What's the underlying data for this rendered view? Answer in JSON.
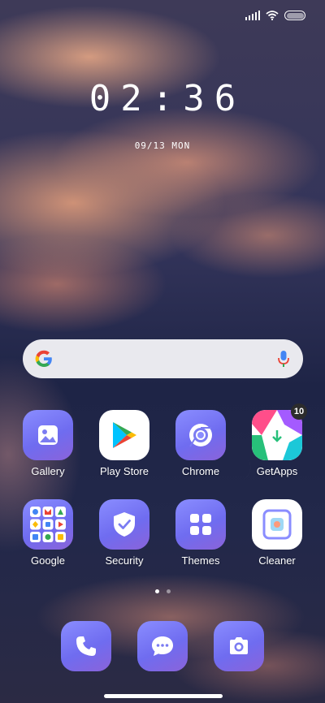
{
  "status_bar": {
    "icons": [
      "signal-icon",
      "wifi-icon",
      "battery-icon"
    ]
  },
  "clock": {
    "time": "02:36",
    "date": "09/13 MON"
  },
  "search": {
    "icons": [
      "google-logo",
      "mic-icon"
    ],
    "colors": [
      "#4285F4",
      "#EA4335",
      "#FBBC05",
      "#34A853"
    ]
  },
  "apps": [
    {
      "label": "Gallery",
      "icon": "gallery-icon"
    },
    {
      "label": "Play Store",
      "icon": "play-store-icon"
    },
    {
      "label": "Chrome",
      "icon": "chrome-icon"
    },
    {
      "label": "GetApps",
      "icon": "getapps-icon",
      "badge": "10"
    },
    {
      "label": "Google",
      "icon": "google-folder-icon"
    },
    {
      "label": "Security",
      "icon": "security-icon"
    },
    {
      "label": "Themes",
      "icon": "themes-icon"
    },
    {
      "label": "Cleaner",
      "icon": "cleaner-icon"
    }
  ],
  "page_indicator": {
    "count": 2,
    "active": 1
  },
  "dock": [
    {
      "icon": "phone-icon"
    },
    {
      "icon": "messages-icon"
    },
    {
      "icon": "camera-icon"
    }
  ],
  "colors": {
    "icon_gradient_start": "#8a8dff",
    "icon_gradient_end": "#6f6cf0",
    "search_bar_bg": "#e9e9ee"
  }
}
